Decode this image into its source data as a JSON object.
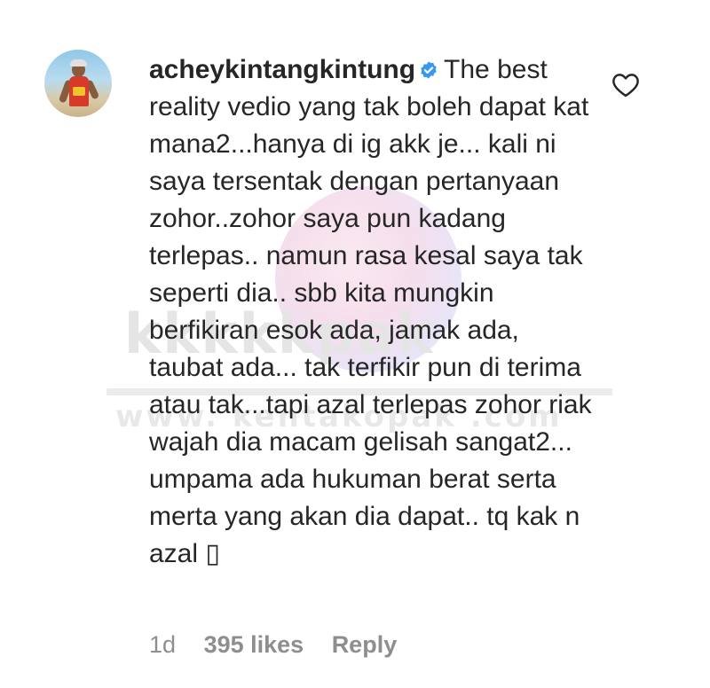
{
  "comment": {
    "username": "acheykintangkintung",
    "verified_icon": "verified-badge-icon",
    "text": "The best reality vedio yang tak boleh dapat kat mana2...hanya di ig akk je... kali ni saya tersentak dengan pertanyaan zohor..zohor saya pun kadang terlepas.. namun rasa kesal saya tak seperti dia.. sbb kita mungkin berfikiran esok ada, jamak ada, taubat ada... tak terfikir pun di terima atau tak...tapi azal terlepas zohor riak wajah dia macam gelisah sangat2... umpama ada hukuman berat serta merta yang akan dia dapat.. tq kak n azal ▯",
    "like_icon": "heart-outline-icon"
  },
  "meta": {
    "time": "1d",
    "likes": "395 likes",
    "reply_label": "Reply"
  },
  "colors": {
    "text": "#262626",
    "meta": "#8e8e8e",
    "verified": "#3897f0",
    "background": "#ffffff"
  }
}
